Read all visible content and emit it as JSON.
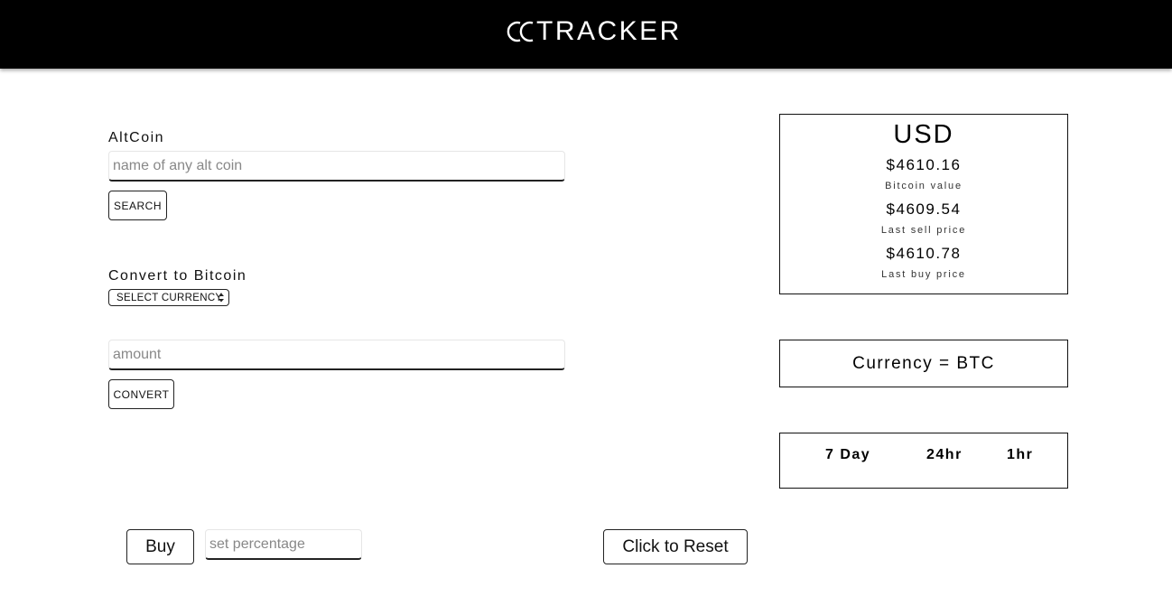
{
  "header": {
    "logo_text": "TRACKER",
    "logo_mark": "cc-circles-logo",
    "bg_color": "#000000"
  },
  "altcoin": {
    "label": "AltCoin",
    "placeholder": "name of any alt coin",
    "search_label": "SEARCH"
  },
  "convert": {
    "label": "Convert to Bitcoin",
    "select_value": "SELECT CURRENCY",
    "amount_placeholder": "amount",
    "convert_label": "CONVERT"
  },
  "price_card": {
    "currency": "USD",
    "bitcoin_value": "$4610.16",
    "bitcoin_value_label": "Bitcoin value",
    "last_sell": "$4609.54",
    "last_sell_label": "Last sell price",
    "last_buy": "$4610.78",
    "last_buy_label": "Last buy price"
  },
  "currency_card": {
    "text": "Currency = BTC"
  },
  "timeframes": {
    "items": [
      "7 Day",
      "24hr",
      "1hr"
    ]
  },
  "trade": {
    "buy_label": "Buy",
    "percentage_placeholder": "set percentage",
    "reset_label": "Click to Reset"
  }
}
